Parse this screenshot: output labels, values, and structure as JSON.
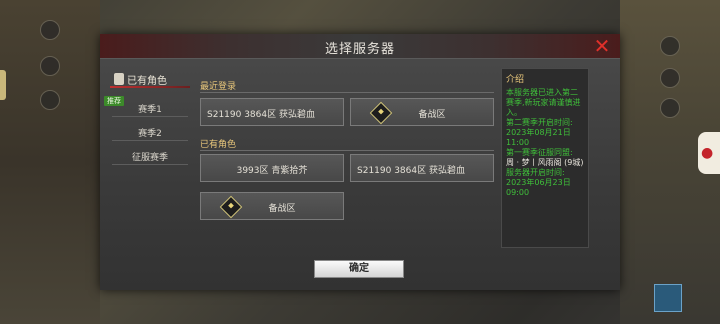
{
  "dialog": {
    "title": "选择服务器"
  },
  "sidebar": {
    "owned_label": "已有角色",
    "badge": "推荐",
    "items": [
      {
        "label": "赛季1"
      },
      {
        "label": "赛季2"
      },
      {
        "label": "征服赛季"
      }
    ]
  },
  "recent": {
    "label": "最近登录",
    "buttons": [
      {
        "label": "S21190 3864区 获弘碧血"
      },
      {
        "label": "备战区"
      }
    ]
  },
  "owned": {
    "label": "已有角色",
    "buttons": [
      {
        "label": "3993区 青紫拾芥"
      },
      {
        "label": "S21190 3864区 获弘碧血"
      },
      {
        "label": "备战区"
      }
    ]
  },
  "info": {
    "title": "介绍",
    "lines": [
      {
        "text": "本服务器已进入第二赛季,新玩家请谨慎进入。",
        "color": "green"
      },
      {
        "text": "第二赛季开启时间:",
        "color": "green"
      },
      {
        "text": "2023年08月21日",
        "color": "green"
      },
      {
        "text": "11:00",
        "color": "green"
      },
      {
        "text": "第一赛季征服同盟:",
        "color": "green"
      },
      {
        "text": "周 · 梦丨风雨阁 (9城)",
        "color": "white"
      },
      {
        "text": "服务器开启时间:",
        "color": "green"
      },
      {
        "text": "2023年06月23日",
        "color": "green"
      },
      {
        "text": "09:00",
        "color": "green"
      }
    ]
  },
  "confirm_label": "确定",
  "colors": {
    "accent_red": "#e0302a",
    "section_gold": "#e6c57a",
    "info_green": "#3fbf3a"
  }
}
